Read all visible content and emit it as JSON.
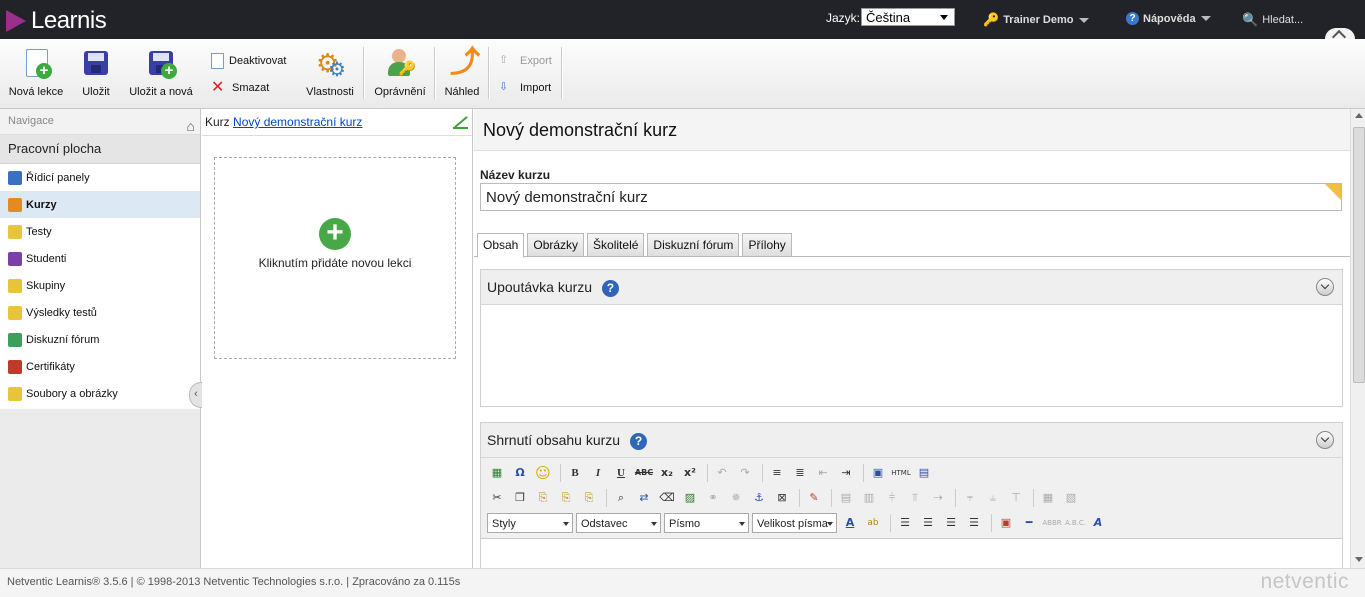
{
  "topbar": {
    "logo": "Learnis",
    "language_label": "Jazyk:",
    "language_value": "Čeština",
    "user": "Trainer Demo",
    "help": "Nápověda",
    "search": "Hledat..."
  },
  "toolbar": {
    "new_lesson": "Nová lekce",
    "save": "Uložit",
    "save_new": "Uložit a nová",
    "deactivate": "Deaktivovat",
    "delete": "Smazat",
    "properties": "Vlastnosti",
    "permissions": "Oprávnění",
    "preview": "Náhled",
    "export": "Export",
    "import": "Import"
  },
  "nav": {
    "header": "Navigace",
    "workspace": "Pracovní plocha",
    "items": [
      {
        "label": "Řídicí panely",
        "icon": "pin-icon",
        "color": "#3a6fc2"
      },
      {
        "label": "Kurzy",
        "icon": "courses-icon",
        "color": "#e58a1f"
      },
      {
        "label": "Testy",
        "icon": "tests-icon",
        "color": "#e8c43a"
      },
      {
        "label": "Studenti",
        "icon": "students-icon",
        "color": "#7a3fa8"
      },
      {
        "label": "Skupiny",
        "icon": "groups-icon",
        "color": "#e8c43a"
      },
      {
        "label": "Výsledky testů",
        "icon": "results-icon",
        "color": "#e8c43a"
      },
      {
        "label": "Diskuzní fórum",
        "icon": "forum-icon",
        "color": "#3aa05a"
      },
      {
        "label": "Certifikáty",
        "icon": "certificate-icon",
        "color": "#c0392b"
      },
      {
        "label": "Soubory a obrázky",
        "icon": "folder-icon",
        "color": "#e8c43a"
      }
    ]
  },
  "middle": {
    "course_prefix": "Kurz",
    "course_link": "Nový demonstrační kurz",
    "add_lesson_text": "Kliknutím přidáte novou lekci"
  },
  "main": {
    "title": "Nový demonstrační kurz",
    "name_label": "Název kurzu",
    "name_value": "Nový demonstrační kurz",
    "tabs": [
      "Obsah",
      "Obrázky",
      "Školitelé",
      "Diskuzní fórum",
      "Přílohy"
    ],
    "panel1_title": "Upoutávka kurzu",
    "panel2_title": "Shrnutí obsahu kurzu",
    "editor": {
      "styles": "Styly",
      "paragraph": "Odstavec",
      "font": "Písmo",
      "font_size": "Velikost písma"
    }
  },
  "footer": {
    "text": "Netventic Learnis® 3.5.6 | © 1998-2013 Netventic Technologies s.r.o. | Zpracováno za 0.115s",
    "brand": "netventic"
  }
}
